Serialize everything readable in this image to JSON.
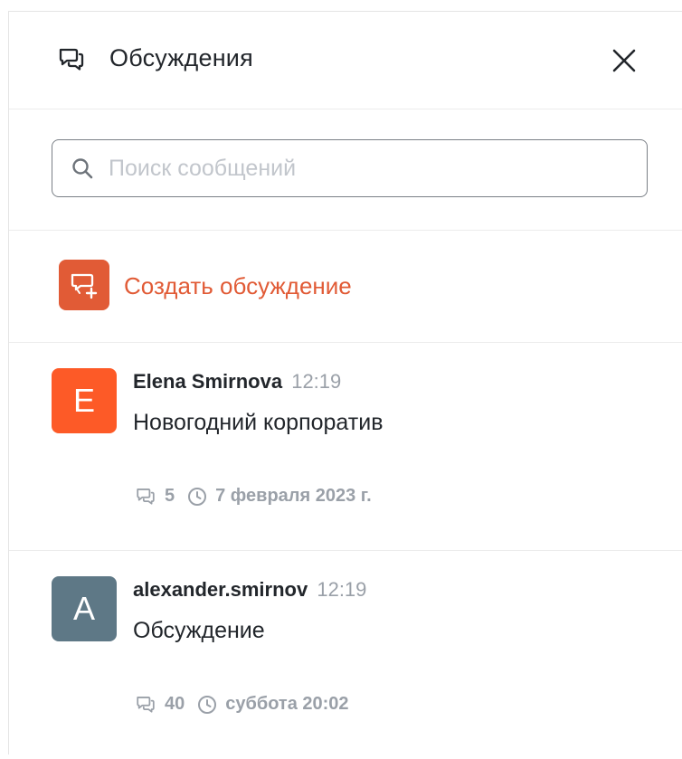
{
  "panel": {
    "title": "Обсуждения",
    "close_icon": "close-icon",
    "header_icon": "discussions-icon"
  },
  "search": {
    "placeholder": "Поиск сообщений",
    "value": ""
  },
  "create": {
    "label": "Создать обсуждение",
    "accent_color": "#e15b36"
  },
  "threads": [
    {
      "avatar_letter": "E",
      "avatar_color": "#fd5a27",
      "author": "Elena Smirnova",
      "time": "12:19",
      "subject": "Новогодний корпоратив",
      "replies": "5",
      "last_activity": "7 февраля 2023 г."
    },
    {
      "avatar_letter": "A",
      "avatar_color": "#5e7886",
      "author": "alexander.smirnov",
      "time": "12:19",
      "subject": "Обсуждение",
      "replies": "40",
      "last_activity": "суббота 20:02"
    }
  ]
}
